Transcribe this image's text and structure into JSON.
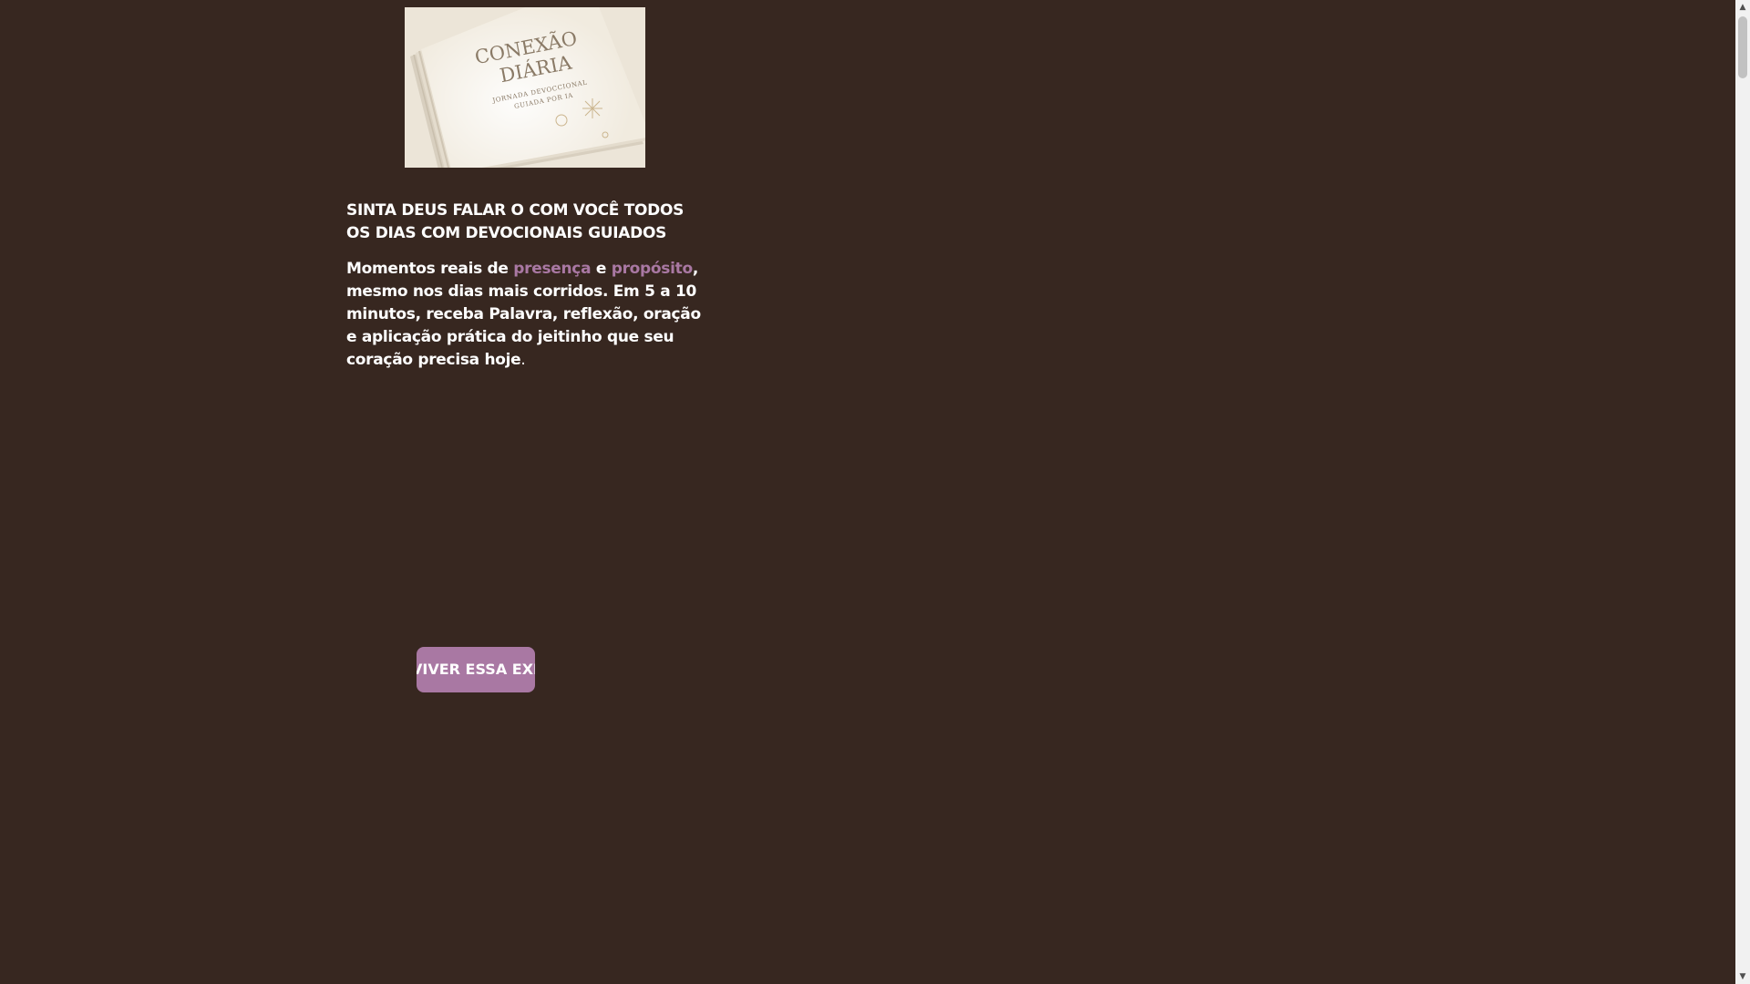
{
  "cover": {
    "title_line1": "CONEXÃO",
    "title_line2": "DIÁRIA",
    "subtitle_line1": "JORNADA DEVOCCIONAL",
    "subtitle_line2": "GUIADA POR IA"
  },
  "headline": "SINTA DEUS FALAR O COM VOCÊ TODOS OS DIAS COM DEVOCIONAIS GUIADOS",
  "body": {
    "part1": "Momentos reais de ",
    "accent1": "presença",
    "part2": " e ",
    "accent2": "propósito",
    "part3": ", mesmo nos dias mais corridos. Em 5 a 10 minutos, receba Palavra, reflexão, oração e aplicação prática do jeitinho que seu coração precisa hoje",
    "period": "."
  },
  "cta": {
    "label": "QUERO VIVER ESSA EXPERIÊNCIA"
  },
  "scrollbar": {
    "up_icon": "▲",
    "down_icon": "▼"
  },
  "colors": {
    "background": "#372720",
    "accent": "#a978a3",
    "text": "#ffffff"
  }
}
